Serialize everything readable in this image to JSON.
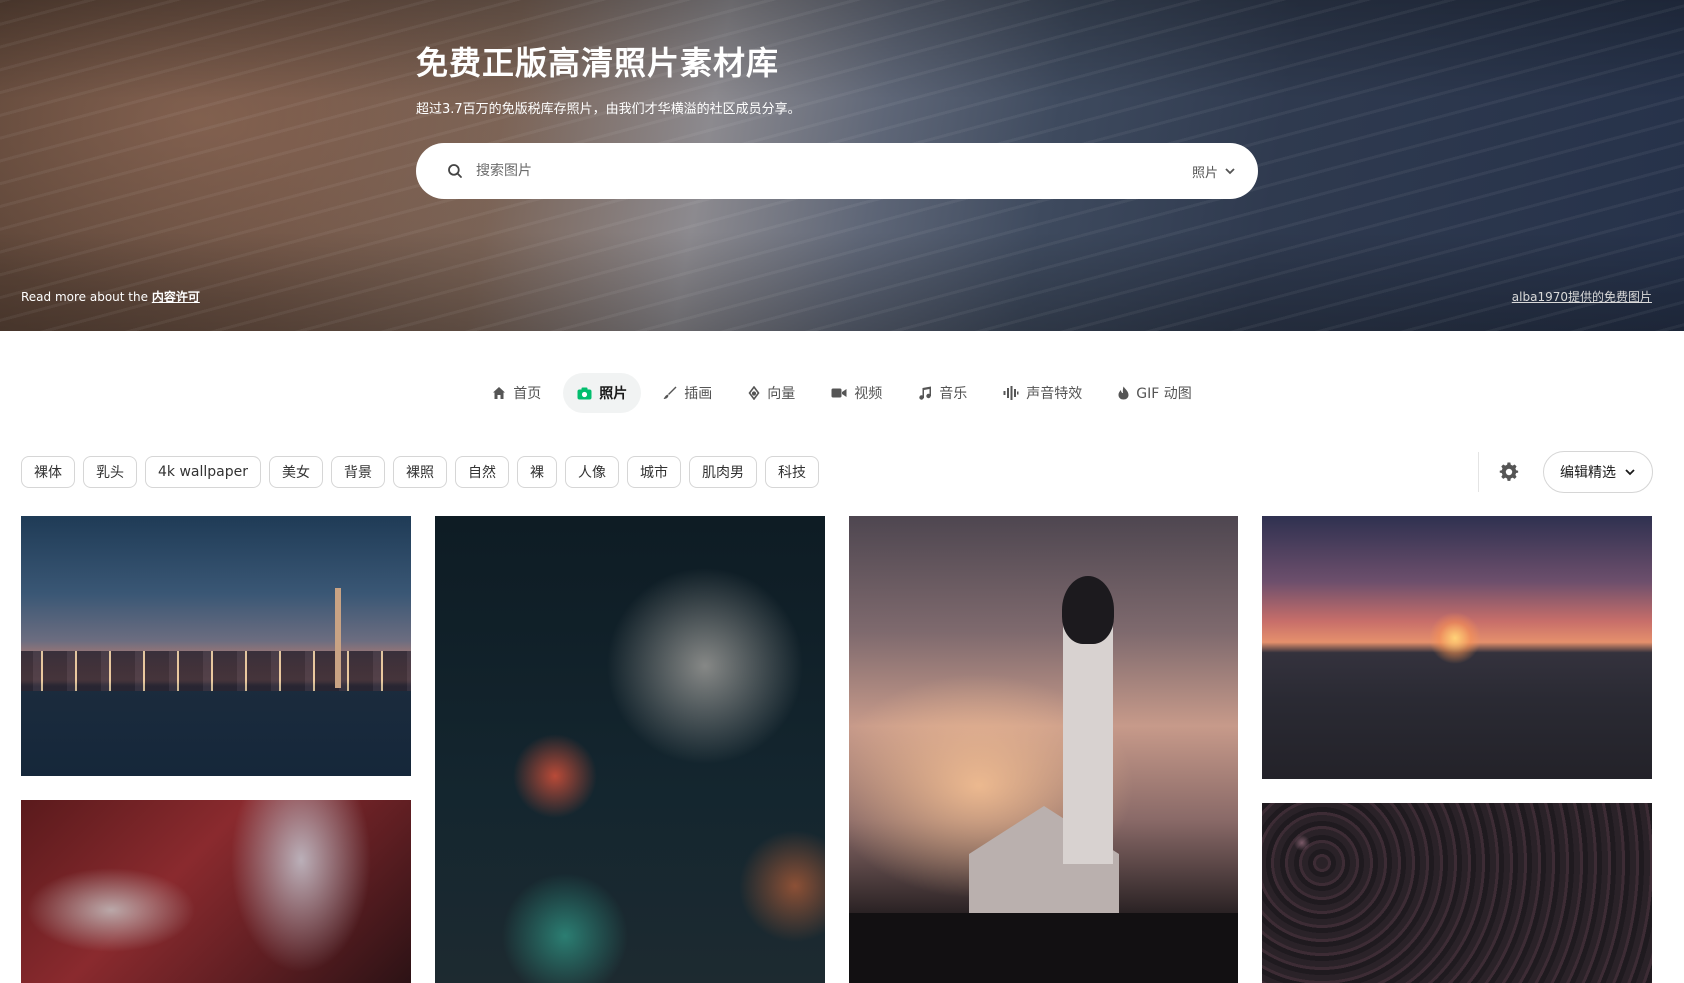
{
  "hero": {
    "title": "免费正版高清照片素材库",
    "subtitle": "超过3.7百万的免版税库存照片，由我们才华横溢的社区成员分享。",
    "search_placeholder": "搜索图片",
    "search_type": "照片",
    "credit_left_prefix": "Read more about the ",
    "credit_left_link": "内容许可",
    "credit_right": "alba1970提供的免费图片"
  },
  "nav": {
    "items": [
      {
        "label": "首页",
        "icon": "home-icon"
      },
      {
        "label": "照片",
        "icon": "camera-icon",
        "active": true
      },
      {
        "label": "插画",
        "icon": "brush-icon"
      },
      {
        "label": "向量",
        "icon": "pen-nib-icon"
      },
      {
        "label": "视频",
        "icon": "video-icon"
      },
      {
        "label": "音乐",
        "icon": "music-icon"
      },
      {
        "label": "声音特效",
        "icon": "waveform-icon"
      },
      {
        "label": "GIF 动图",
        "icon": "flame-icon"
      }
    ]
  },
  "tags": [
    "裸体",
    "乳头",
    "4k wallpaper",
    "美女",
    "背景",
    "裸照",
    "自然",
    "裸",
    "人像",
    "城市",
    "肌肉男",
    "科技"
  ],
  "toolbar": {
    "settings_icon": "gear-icon",
    "sort_label": "编辑精选"
  },
  "colors": {
    "accent": "#02be6e",
    "tag_border": "#d6d6d6",
    "active_tab_bg": "#f1f3f3"
  }
}
